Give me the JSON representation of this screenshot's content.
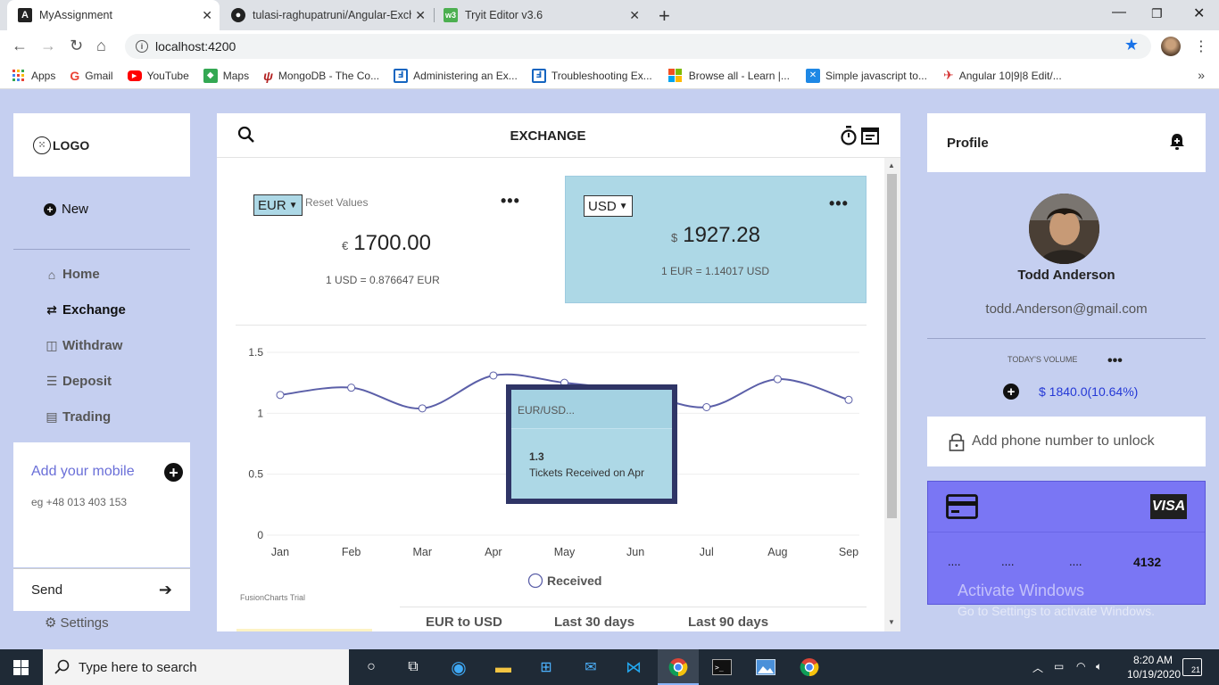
{
  "browser": {
    "tabs": [
      {
        "title": "MyAssignment",
        "icon": "A"
      },
      {
        "title": "tulasi-raghupatruni/Angular-Exch",
        "icon": "gh"
      },
      {
        "title": "Tryit Editor v3.6",
        "icon": "w3"
      }
    ],
    "url": "localhost:4200",
    "bookmarks": [
      {
        "label": "Apps",
        "color": "#4285f4"
      },
      {
        "label": "Gmail",
        "color": "#ea4335"
      },
      {
        "label": "YouTube",
        "color": "#ff0000"
      },
      {
        "label": "Maps",
        "color": "#34a853"
      },
      {
        "label": "MongoDB - The Co...",
        "color": "#b22222"
      },
      {
        "label": "Administering an Ex...",
        "color": "#1565c0"
      },
      {
        "label": "Troubleshooting Ex...",
        "color": "#1565c0"
      },
      {
        "label": "Browse all - Learn |...",
        "color": "#f25022"
      },
      {
        "label": "Simple javascript to...",
        "color": "#1e88e5"
      },
      {
        "label": "Angular 10|9|8 Edit/...",
        "color": "#d32f2f"
      }
    ]
  },
  "sidebar": {
    "logo": "LOGO",
    "new_label": "New",
    "nav": [
      {
        "label": "Home",
        "icon": "home-icon"
      },
      {
        "label": "Exchange",
        "icon": "exchange-icon"
      },
      {
        "label": "Withdraw",
        "icon": "withdraw-icon"
      },
      {
        "label": "Deposit",
        "icon": "deposit-icon"
      },
      {
        "label": "Trading",
        "icon": "trading-icon"
      }
    ],
    "mobile_title": "Add your mobile",
    "mobile_placeholder": "eg +48 013 403 153",
    "send_label": "Send",
    "settings_label": "Settings"
  },
  "main": {
    "title": "EXCHANGE",
    "from": {
      "currency": "EUR",
      "symbol": "€",
      "amount": "1700.00",
      "rate": "1 USD = 0.876647 EUR",
      "reset": "Reset Values"
    },
    "to": {
      "currency": "USD",
      "symbol": "$",
      "amount": "1927.28",
      "rate": "1 EUR = 1.14017 USD"
    },
    "trial_label": "FusionCharts Trial",
    "bottom_tabs": [
      "EUR to USD",
      "Last 30 days",
      "Last 90 days"
    ],
    "tooltip": {
      "title": "EUR/USD...",
      "value": "1.3",
      "label": "Tickets Received on Apr"
    }
  },
  "chart_data": {
    "type": "line",
    "categories": [
      "Jan",
      "Feb",
      "Mar",
      "Apr",
      "May",
      "Jun",
      "Jul",
      "Aug",
      "Sep"
    ],
    "series": [
      {
        "name": "Received",
        "values": [
          1.15,
          1.21,
          1.04,
          1.31,
          1.25,
          1.18,
          1.05,
          1.28,
          1.11
        ]
      }
    ],
    "yticks": [
      "0",
      "0.5",
      "1",
      "1.5"
    ],
    "ylim": [
      0,
      1.5
    ],
    "legend": "bottom",
    "color": "#5b5fa8"
  },
  "profile": {
    "title": "Profile",
    "name": "Todd Anderson",
    "email": "todd.Anderson@gmail.com",
    "volume_label": "TODAY'S VOLUME",
    "volume_value": "$ 1840.0(10.64%)",
    "phone_prompt": "Add phone number to unlock",
    "card": {
      "brand": "VISA",
      "masked": [
        "....",
        "....",
        "...."
      ],
      "last4": "4132"
    },
    "watermark": "Activate Windows",
    "watermark_sub": "Go to Settings to activate Windows."
  },
  "taskbar": {
    "search_placeholder": "Type here to search",
    "time": "8:20 AM",
    "date": "10/19/2020",
    "notifications": "21"
  }
}
